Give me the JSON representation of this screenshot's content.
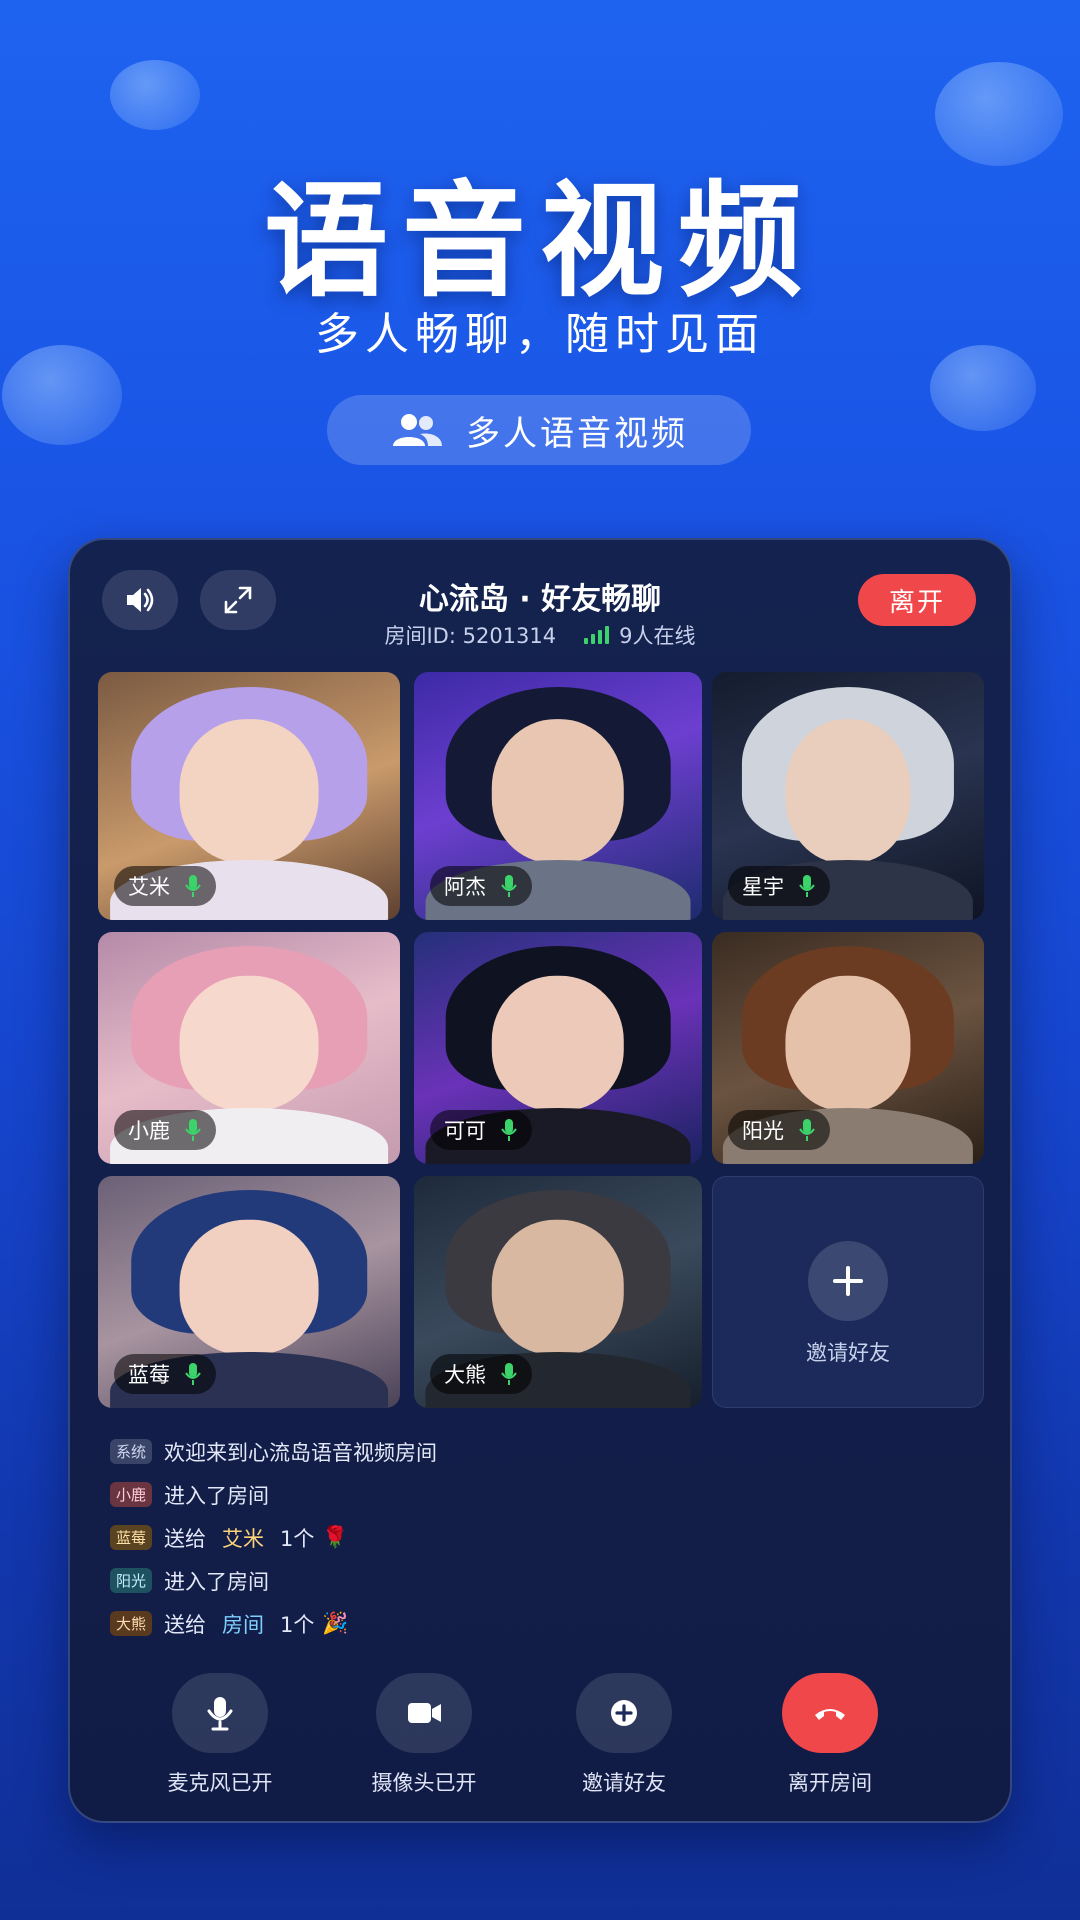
{
  "hero": {
    "title": "语音视频",
    "subtitle": "多人畅聊，随时见面",
    "pill_label": "多人语音视频",
    "pill_icon": "users-icon"
  },
  "room": {
    "title": "心流岛 · 好友畅聊",
    "id_text": "房间ID: 5201314",
    "online_text": "9人在线",
    "leave_label": "离开"
  },
  "participants": [
    {
      "name": "艾米",
      "mic": "on"
    },
    {
      "name": "阿杰",
      "mic": "on"
    },
    {
      "name": "星宇",
      "mic": "on"
    },
    {
      "name": "小鹿",
      "mic": "on"
    },
    {
      "name": "可可",
      "mic": "on"
    },
    {
      "name": "阳光",
      "mic": "on"
    },
    {
      "name": "蓝莓",
      "mic": "on"
    },
    {
      "name": "大熊",
      "mic": "on"
    }
  ],
  "invite_tile": {
    "label": "邀请好友"
  },
  "chat": [
    {
      "tag": "系统",
      "text": "欢迎来到心流岛语音视频房间"
    },
    {
      "tag": "小鹿",
      "text": "进入了房间"
    },
    {
      "tag": "蓝莓",
      "verb": "送给",
      "target": "艾米",
      "count": "1个",
      "gift": "🌹"
    },
    {
      "tag": "阳光",
      "text": "进入了房间"
    },
    {
      "tag": "大熊",
      "verb": "送给",
      "target": "房间",
      "count": "1个",
      "gift": "🎉"
    }
  ],
  "controls": [
    {
      "label": "麦克风已开",
      "icon": "microphone-icon"
    },
    {
      "label": "摄像头已开",
      "icon": "camera-icon"
    },
    {
      "label": "邀请好友",
      "icon": "plus-circle-icon"
    },
    {
      "label": "离开房间",
      "icon": "hang-up-icon"
    }
  ],
  "colors": {
    "accent_red": "#f0474a",
    "mic_green": "#3cd36b",
    "panel_bg": "#14224f"
  }
}
